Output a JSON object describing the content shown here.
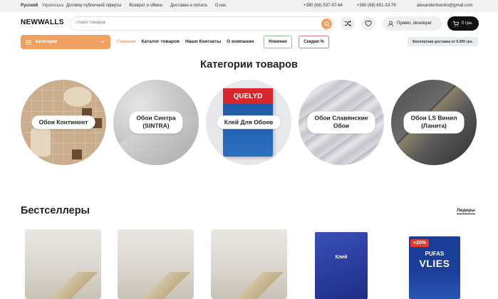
{
  "topbar": {
    "lang_active": "Русский",
    "lang_other": "Українська",
    "links": [
      "Договор публичной оферты",
      "Возврат и обмен",
      "Доставка и оплата",
      "О нас"
    ],
    "phones": [
      "+380 (68) 537-97-64",
      "+380 (68) 651-33-76"
    ],
    "email": "alexanderlisenko@gmail.com"
  },
  "header": {
    "logo": "NEWWALLS",
    "search_placeholder": "Поиск товаров",
    "user_label": "Привет, developer",
    "cart_label": "0 грн."
  },
  "nav": {
    "categories_label": "Категории",
    "items": [
      "Главная",
      "Каталог товаров",
      "Наши Контакты",
      "О компании"
    ],
    "active_index": 0,
    "pill_new": "Новинки",
    "pill_sale": "Скидки %",
    "delivery": "Бесплатная доставка от 5.000 грн."
  },
  "categories": {
    "title": "Категории товаров",
    "items": [
      {
        "line1": "Обои Континент",
        "line2": ""
      },
      {
        "line1": "Обои Синтра",
        "line2": "(SINTRA)"
      },
      {
        "line1": "Клей Для Обоев",
        "line2": ""
      },
      {
        "line1": "Обои Славянские",
        "line2": "Обои"
      },
      {
        "line1": "Обои LS Винил",
        "line2": "(Ланита)"
      }
    ],
    "product_brand": "QUELYD"
  },
  "bestsellers": {
    "title": "Бестселлеры",
    "link": "Лидеры",
    "products": [
      {
        "image": "wallpaper-roll"
      },
      {
        "image": "wallpaper-roll"
      },
      {
        "image": "wallpaper-roll"
      },
      {
        "image": "glue-box",
        "text": "Клей"
      },
      {
        "image": "glue-box",
        "badge": "+20%",
        "brand": "PUFAS",
        "name": "VLIES"
      }
    ]
  },
  "colors": {
    "accent": "#f0a160",
    "dark": "#111111",
    "new_border": "#8fc58f",
    "sale_border": "#e07b7b"
  }
}
